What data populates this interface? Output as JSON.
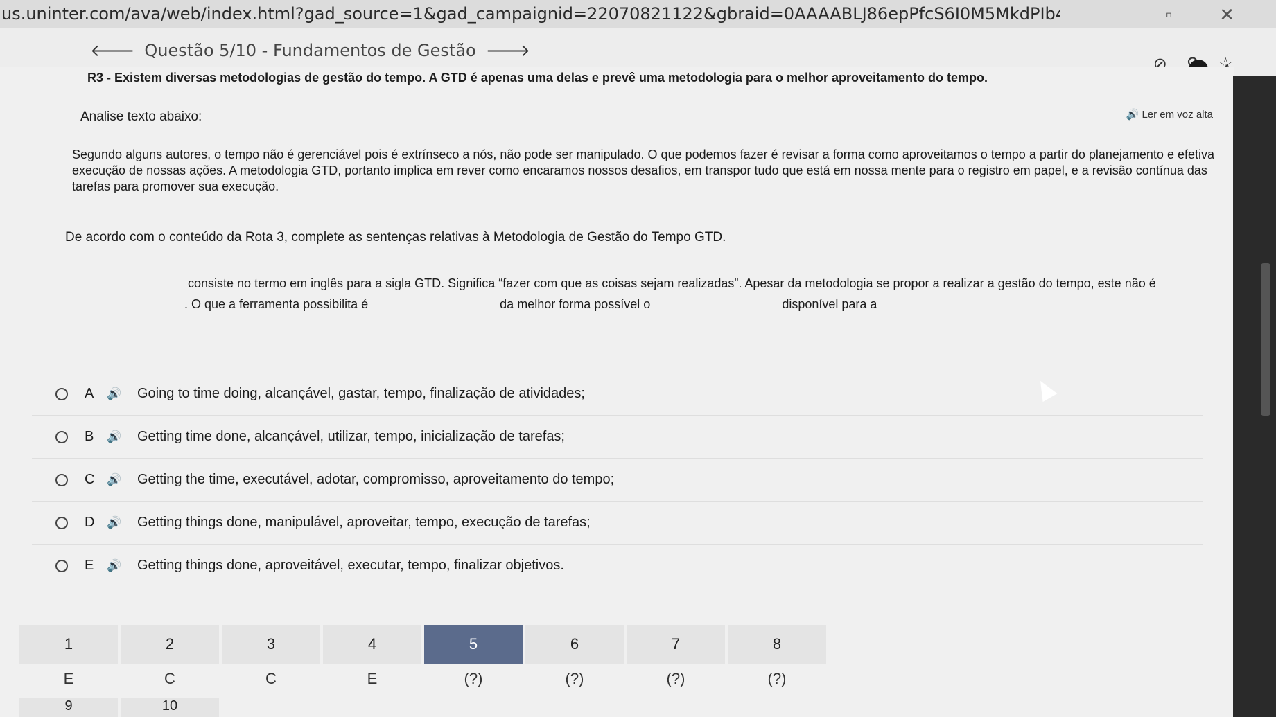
{
  "browser": {
    "url": "us.uninter.com/ava/web/index.html?gad_source=1&gad_campaignid=22070821122&gbraid=0AAAABLJ86epPfcS6I0M5MkdPIb4bL48u&gclid=CjwKCAjwrav..."
  },
  "header": {
    "title": "Questão 5/10 - Fundamentos de Gestão"
  },
  "question": {
    "prompt": "R3 - Existem diversas metodologias de gestão do tempo. A GTD é apenas uma delas e prevê uma metodologia para o melhor aproveitamento do tempo.",
    "read_aloud": "Ler em voz alta",
    "analyze_label": "Analise texto abaixo:",
    "paragraph": "Segundo alguns autores, o tempo não é gerenciável pois é extrínseco a nós, não pode ser manipulado. O que podemos fazer é revisar a forma como aproveitamos o tempo a partir do planejamento e efetiva execução de nossas ações. A metodologia GTD, portanto implica em rever como encaramos nossos desafios, em transpor tudo que está em nossa mente para o registro em papel, e a revisão contínua das tarefas para promover sua execução.",
    "instruction": "De acordo com o conteúdo da Rota 3, complete as sentenças relativas à Metodologia de Gestão do Tempo GTD.",
    "sentence_part1": "consiste no termo em inglês para a sigla GTD. Significa “fazer com que as coisas sejam realizadas”. Apesar da metodologia se propor a realizar a gestão do tempo, este não é",
    "sentence_part2": ". O que a ferramenta possibilita é",
    "sentence_part3": "da melhor forma possível o",
    "sentence_part4": "disponível para a"
  },
  "options": [
    {
      "letter": "A",
      "text": "Going to time doing, alcançável, gastar, tempo, finalização de atividades;"
    },
    {
      "letter": "B",
      "text": "Getting time done, alcançável, utilizar, tempo, inicialização de tarefas;"
    },
    {
      "letter": "C",
      "text": "Getting the time, executável, adotar, compromisso, aproveitamento do tempo;"
    },
    {
      "letter": "D",
      "text": "Getting things done, manipulável, aproveitar, tempo, execução de tarefas;"
    },
    {
      "letter": "E",
      "text": "Getting things done, aproveitável, executar, tempo, finalizar objetivos."
    }
  ],
  "question_nav": [
    {
      "num": "1",
      "answer": "E"
    },
    {
      "num": "2",
      "answer": "C"
    },
    {
      "num": "3",
      "answer": "C"
    },
    {
      "num": "4",
      "answer": "E"
    },
    {
      "num": "5",
      "answer": "(?)"
    },
    {
      "num": "6",
      "answer": "(?)"
    },
    {
      "num": "7",
      "answer": "(?)"
    },
    {
      "num": "8",
      "answer": "(?)"
    }
  ],
  "question_nav_row2": [
    "9",
    "10"
  ],
  "colors": {
    "active_question": "#5b6b8c",
    "background": "#f0f0f0"
  }
}
